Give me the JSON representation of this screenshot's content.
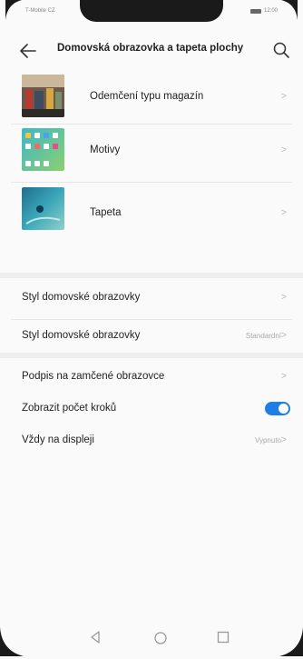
{
  "status": {
    "carrier": "T-Mobile CZ",
    "time": "12:00"
  },
  "header": {
    "title": "Domovská obrazovka a tapeta plochy"
  },
  "icons": {
    "back": "back-arrow-icon",
    "search": "search-icon",
    "chevron": "chevron-right-icon"
  },
  "media_items": [
    {
      "label": "Odemčení typu magazín"
    },
    {
      "label": "Motivy"
    },
    {
      "label": "Tapeta"
    }
  ],
  "settings_group1": [
    {
      "label": "Styl domovské obrazovky",
      "value": ""
    },
    {
      "label": "Styl domovské obrazovky",
      "value": "Standardní"
    }
  ],
  "settings_group2": [
    {
      "label": "Podpis na zamčené obrazovce",
      "value": ""
    },
    {
      "label": "Zobrazit počet kroků",
      "toggle": true
    },
    {
      "label": "Vždy na displeji",
      "value": "Vypnuto"
    }
  ],
  "colors": {
    "accent": "#1f7de6",
    "text": "#222222",
    "muted": "#aaaaaa"
  },
  "chevron_glyph": ">"
}
